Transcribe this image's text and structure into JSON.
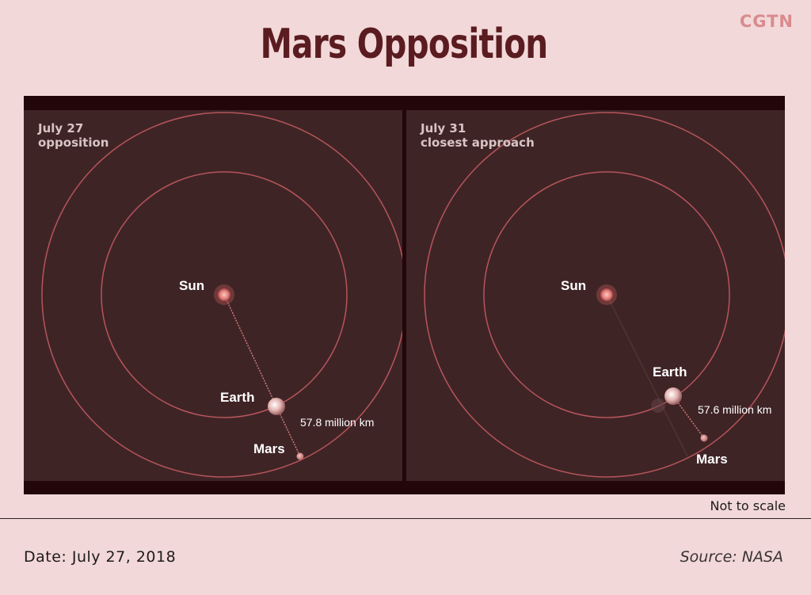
{
  "logo": "CGTN",
  "title": "Mars Opposition",
  "panels": [
    {
      "date_line": "July 27",
      "event_line": "opposition",
      "sun_label": "Sun",
      "earth_label": "Earth",
      "mars_label": "Mars",
      "distance_label": "57.8 million km"
    },
    {
      "date_line": "July 31",
      "event_line": "closest approach",
      "sun_label": "Sun",
      "earth_label": "Earth",
      "mars_label": "Mars",
      "distance_label": "57.6 million km"
    }
  ],
  "scale_note": "Not to scale",
  "date": "Date: July 27, 2018",
  "source": "Source: NASA",
  "colors": {
    "background": "#f2d8d9",
    "panel": "#3f2426",
    "frame": "#230609",
    "orbit": "#b5555a",
    "title": "#5a1c20",
    "logo": "#d98b8e"
  }
}
